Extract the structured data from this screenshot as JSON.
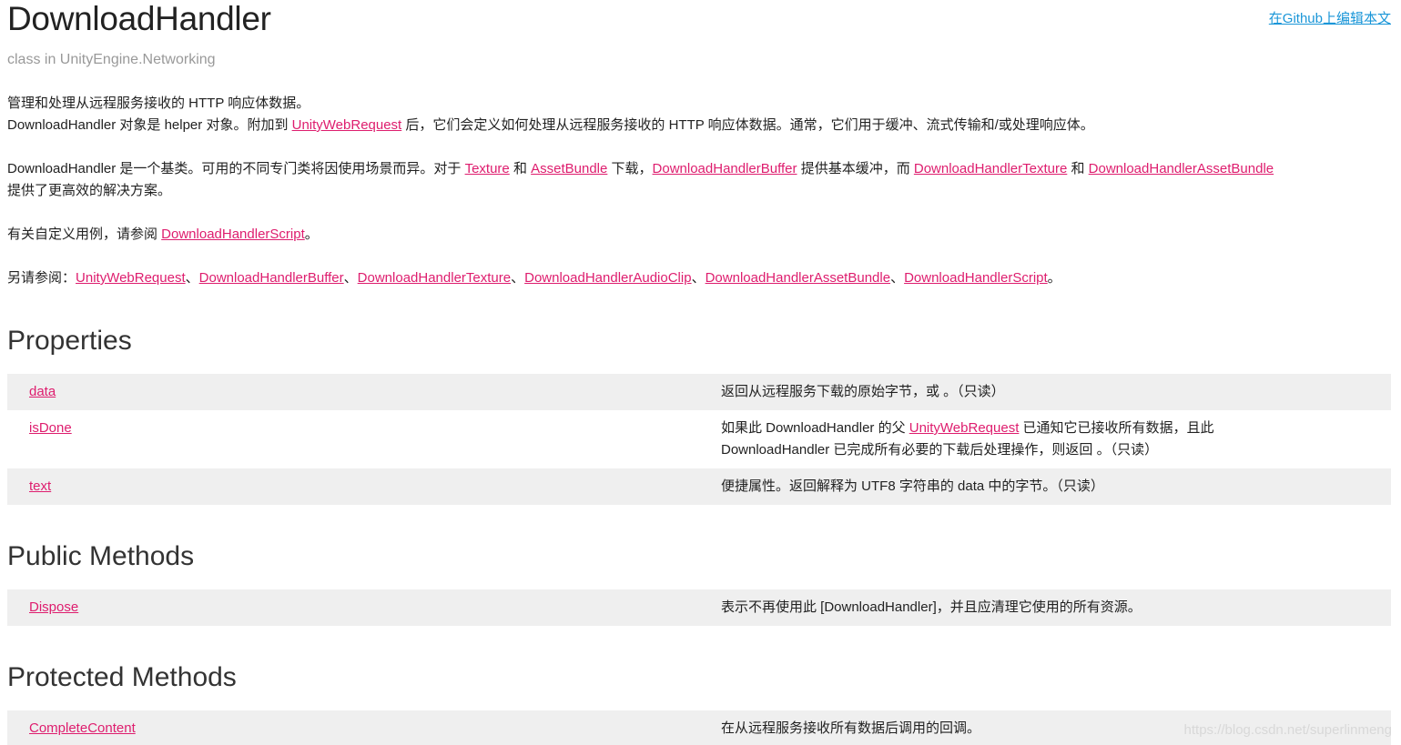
{
  "header": {
    "title": "DownloadHandler",
    "subtitle": "class in UnityEngine.Networking",
    "edit_link": "在Github上编辑本文"
  },
  "description": {
    "p1_line1": "管理和处理从远程服务接收的 HTTP 响应体数据。",
    "p1_line2_a": "DownloadHandler 对象是 helper 对象。附加到 ",
    "p1_line2_link": "UnityWebRequest",
    "p1_line2_b": " 后，它们会定义如何处理从远程服务接收的 HTTP 响应体数据。通常，它们用于缓冲、流式传输和/或处理响应体。",
    "p2_a": "DownloadHandler 是一个基类。可用的不同专门类将因使用场景而异。对于 ",
    "p2_link_texture": "Texture",
    "p2_b": " 和 ",
    "p2_link_assetbundle": "AssetBundle",
    "p2_c": " 下载，",
    "p2_link_buffer": "DownloadHandlerBuffer",
    "p2_d": " 提供基本缓冲，而 ",
    "p2_link_dhtexture": "DownloadHandlerTexture",
    "p2_e": " 和 ",
    "p2_link_dhassetbundle": "DownloadHandlerAssetBundle",
    "p2_f": "提供了更高效的解决方案。",
    "p3_a": "有关自定义用例，请参阅 ",
    "p3_link": "DownloadHandlerScript",
    "p3_b": "。",
    "p4_a": "另请参阅：",
    "p4_links": [
      "UnityWebRequest",
      "DownloadHandlerBuffer",
      "DownloadHandlerTexture",
      "DownloadHandlerAudioClip",
      "DownloadHandlerAssetBundle",
      "DownloadHandlerScript"
    ],
    "p4_sep": "、",
    "p4_end": "。"
  },
  "properties": {
    "heading": "Properties",
    "rows": [
      {
        "name": "data",
        "desc": "返回从远程服务下载的原始字节，或 。（只读）"
      },
      {
        "name": "isDone",
        "desc_a": "如果此 DownloadHandler 的父 ",
        "desc_link": "UnityWebRequest",
        "desc_b": " 已通知它已接收所有数据，且此",
        "desc_c": "DownloadHandler 已完成所有必要的下载后处理操作，则返回 。（只读）"
      },
      {
        "name": "text",
        "desc": "便捷属性。返回解释为 UTF8 字符串的 data 中的字节。（只读）"
      }
    ]
  },
  "public_methods": {
    "heading": "Public Methods",
    "rows": [
      {
        "name": "Dispose",
        "desc": "表示不再使用此 [DownloadHandler]，并且应清理它使用的所有资源。"
      }
    ]
  },
  "protected_methods": {
    "heading": "Protected Methods",
    "rows": [
      {
        "name": "CompleteContent",
        "desc": "在从远程服务接收所有数据后调用的回调。"
      }
    ]
  },
  "watermark": "https://blog.csdn.net/superlinmeng",
  "colors": {
    "link": "#de1d6e",
    "edit_link": "#1a96d8",
    "row_shade": "#efefef",
    "subtitle": "#999999"
  }
}
